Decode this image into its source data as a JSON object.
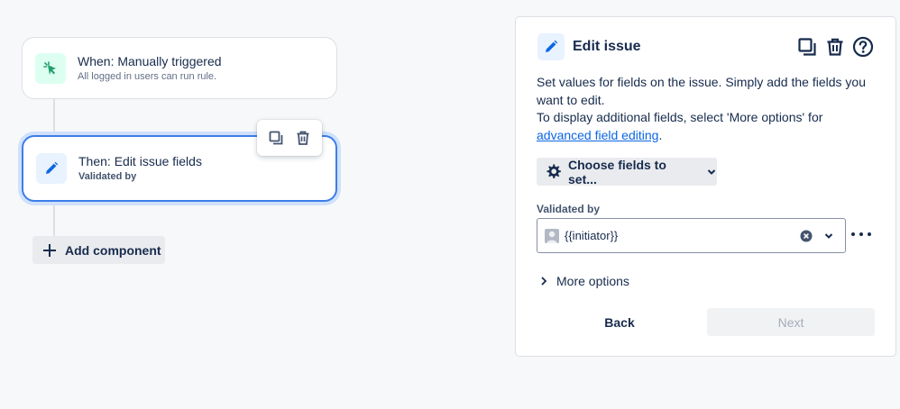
{
  "flow": {
    "trigger": {
      "title": "When: Manually triggered",
      "subtitle": "All logged in users can run rule.",
      "icon": "cursor-click-icon",
      "icon_color": "#22a06b",
      "icon_bg": "#dcfff1"
    },
    "action": {
      "title": "Then: Edit issue fields",
      "subtitle": "Validated by",
      "icon": "pencil-icon",
      "icon_color": "#0c66e4",
      "icon_bg": "#e9f2ff"
    },
    "card_toolbar": {
      "duplicate_icon": "copy-icon",
      "delete_icon": "trash-icon"
    },
    "add_component_label": "Add component"
  },
  "panel": {
    "title": "Edit issue",
    "header_icons": [
      "copy-icon",
      "trash-icon",
      "help-icon"
    ],
    "description_line1": "Set values for fields on the issue. Simply add the fields you want to edit.",
    "description_line2_prefix": "To display additional fields, select 'More options' for ",
    "description_link": "advanced field editing",
    "description_line2_suffix": ".",
    "choose_fields_label": "Choose fields to set...",
    "field": {
      "label": "Validated by",
      "value": "{{initiator}}"
    },
    "more_options_label": "More options",
    "back_label": "Back",
    "next_label": "Next"
  },
  "colors": {
    "accent": "#0c66e4",
    "selected_border": "#3d7de8",
    "text": "#172b4d"
  }
}
